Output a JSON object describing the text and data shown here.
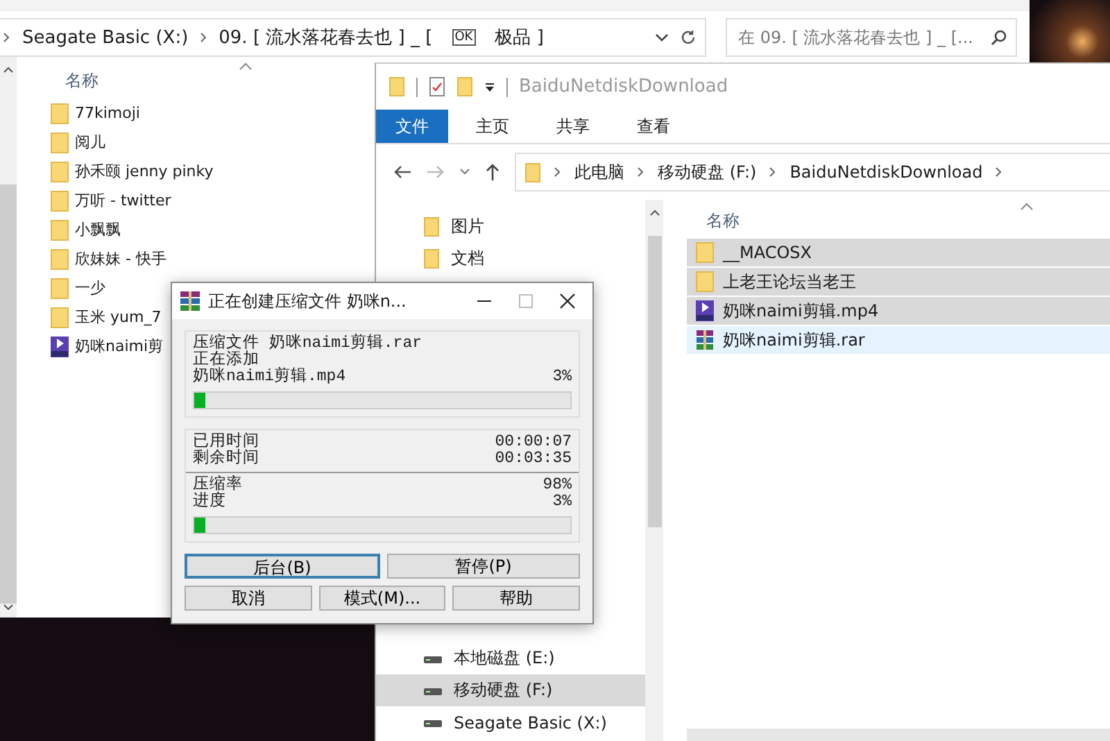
{
  "back_window": {
    "address": {
      "drive": "Seagate Basic (X:)",
      "folder_before": "09. [ 流水落花春去也 ] _ [",
      "folder_badge": "OK",
      "folder_after": "极品 ]"
    },
    "search": {
      "placeholder": "在 09. [ 流水落花春去也 ] _ [..."
    },
    "column": "名称",
    "items": [
      {
        "name": "77kimoji",
        "kind": "folder"
      },
      {
        "name": "阅儿",
        "kind": "folder"
      },
      {
        "name": "孙禾颐 jenny pinky",
        "kind": "folder"
      },
      {
        "name": "万听 - twitter",
        "kind": "folder"
      },
      {
        "name": "小飘飘",
        "kind": "folder"
      },
      {
        "name": "欣妹妹 - 快手",
        "kind": "folder"
      },
      {
        "name": "一少",
        "kind": "folder"
      },
      {
        "name": "玉米 yum_7",
        "kind": "folder"
      },
      {
        "name": "奶咪naimi剪",
        "kind": "video"
      }
    ]
  },
  "front_window": {
    "title": "BaiduNetdiskDownload",
    "ribbon_tabs": [
      {
        "label": "文件",
        "selected": true
      },
      {
        "label": "主页",
        "selected": false
      },
      {
        "label": "共享",
        "selected": false
      },
      {
        "label": "查看",
        "selected": false
      }
    ],
    "address": [
      "此电脑",
      "移动硬盘 (F:)",
      "BaiduNetdiskDownload"
    ],
    "nav_top": [
      {
        "label": "图片"
      },
      {
        "label": "文档"
      }
    ],
    "nav_bottom": [
      {
        "label": "本地磁盘 (E:)",
        "selected": false
      },
      {
        "label": "移动硬盘 (F:)",
        "selected": true
      },
      {
        "label": "Seagate Basic (X:)",
        "selected": false
      }
    ],
    "column": "名称",
    "files": [
      {
        "name": "__MACOSX",
        "kind": "folder",
        "selected": true,
        "hovered": false
      },
      {
        "name": "上老王论坛当老王",
        "kind": "folder",
        "selected": true,
        "hovered": false
      },
      {
        "name": "奶咪naimi剪辑.mp4",
        "kind": "video",
        "selected": true,
        "hovered": false
      },
      {
        "name": "奶咪naimi剪辑.rar",
        "kind": "archive",
        "selected": false,
        "hovered": true
      }
    ]
  },
  "dialog": {
    "title": "正在创建压缩文件 奶咪n...",
    "archive_line": "压缩文件 奶咪naimi剪辑.rar",
    "status": "正在添加",
    "file": {
      "name": "奶咪naimi剪辑.mp4",
      "percent": "3%",
      "level": 0.03
    },
    "times": [
      {
        "label": "已用时间",
        "value": "00:00:07"
      },
      {
        "label": "剩余时间",
        "value": "00:03:35"
      }
    ],
    "stats": [
      {
        "label": "压缩率",
        "value": "98%"
      },
      {
        "label": "进度",
        "value": "3%"
      }
    ],
    "total": {
      "level": 0.03
    },
    "buttons": [
      [
        {
          "label": "后台(B)",
          "focused": true
        },
        {
          "label": "暂停(P)",
          "focused": false
        }
      ],
      [
        {
          "label": "取消",
          "focused": false
        },
        {
          "label": "模式(M)...",
          "focused": false
        },
        {
          "label": "帮助",
          "focused": false
        }
      ]
    ]
  }
}
